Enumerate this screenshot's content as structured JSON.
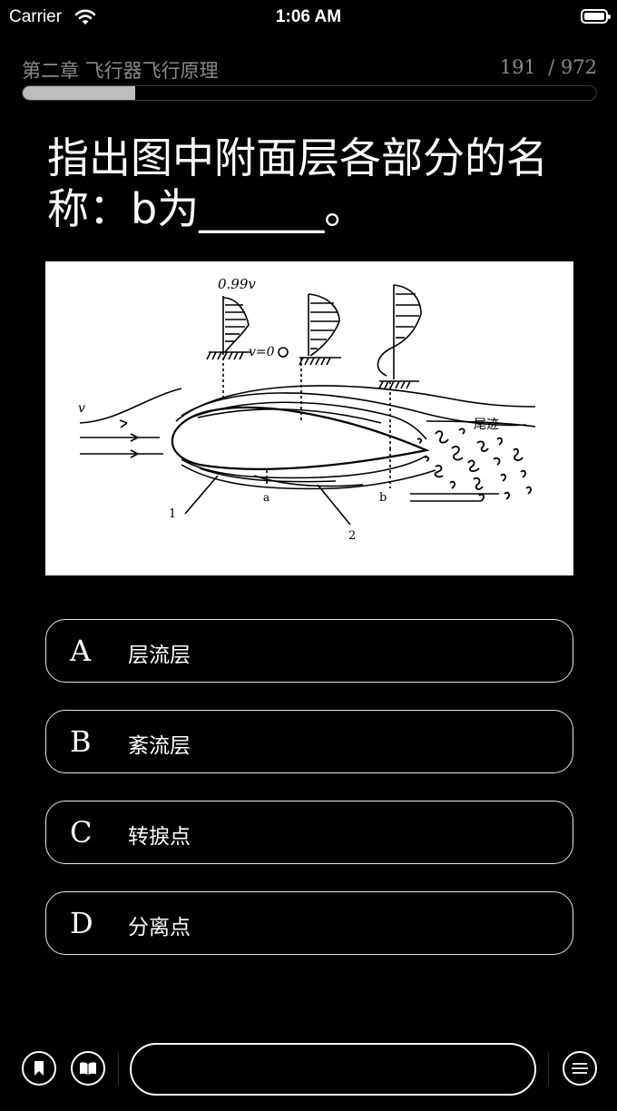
{
  "status_bar": {
    "carrier": "Carrier",
    "time": "1:06 AM"
  },
  "header": {
    "chapter": "第二章  飞行器飞行原理",
    "current": "191",
    "total": "/ 972",
    "progress_fraction": 0.196
  },
  "question": {
    "text": "指出图中附面层各部分的名称：b为______。"
  },
  "figure": {
    "labels": {
      "velocity_099": "0.99v",
      "v_zero": "v=0",
      "v": "v",
      "wake": "尾迹",
      "label_1": "1",
      "label_2": "2",
      "label_a": "a",
      "label_b": "b"
    }
  },
  "options": [
    {
      "letter": "A",
      "text": "层流层"
    },
    {
      "letter": "B",
      "text": "紊流层"
    },
    {
      "letter": "C",
      "text": "转捩点"
    },
    {
      "letter": "D",
      "text": "分离点"
    }
  ],
  "bottom_bar": {
    "left_icons": [
      "bookmark-icon",
      "book-icon"
    ],
    "right_icon": "menu-icon",
    "input_placeholder": ""
  }
}
